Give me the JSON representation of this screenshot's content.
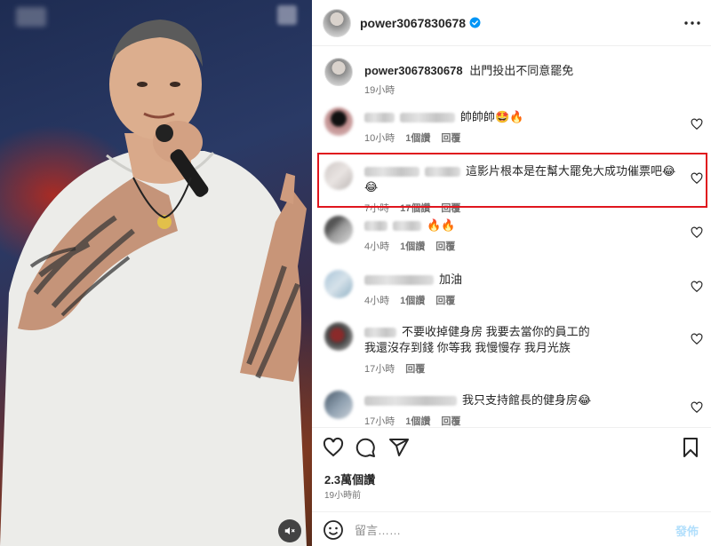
{
  "header": {
    "username": "power3067830678",
    "verified": true
  },
  "caption": {
    "username": "power3067830678",
    "text": "出門投出不同意罷免",
    "time": "19小時"
  },
  "comments": [
    {
      "text": "帥帥帥🤩🔥",
      "time": "10小時",
      "likes": "1個讚",
      "reply": "回覆"
    },
    {
      "text": "這影片根本是在幫大罷免大成功催票吧😂😂",
      "time": "7小時",
      "likes": "17個讚",
      "reply": "回覆",
      "highlighted": true
    },
    {
      "text": "🔥🔥",
      "time": "4小時",
      "likes": "1個讚",
      "reply": "回覆"
    },
    {
      "text": "加油",
      "time": "4小時",
      "likes": "1個讚",
      "reply": "回覆"
    },
    {
      "text_line1": "不要收掉健身房 我要去當你的員工的",
      "text_line2": "我還沒存到錢 你等我 我慢慢存 我月光族",
      "time": "17小時",
      "reply": "回覆"
    },
    {
      "text": "我只支持館長的健身房😂",
      "time": "17小時",
      "likes": "1個讚",
      "reply": "回覆"
    }
  ],
  "post": {
    "likes": "2.3萬個讚",
    "time": "19小時前"
  },
  "composer": {
    "placeholder": "留言……",
    "post_label": "發佈"
  },
  "icons": {
    "like": "heart-icon",
    "comment": "comment-icon",
    "share": "share-icon",
    "save": "bookmark-icon",
    "emoji": "emoji-icon",
    "mute": "mute-icon",
    "more": "more-icon"
  },
  "colors": {
    "highlight": "#e0161e",
    "verified": "#0095f6",
    "post_button": "#b2dffc",
    "meta_text": "#737373"
  }
}
